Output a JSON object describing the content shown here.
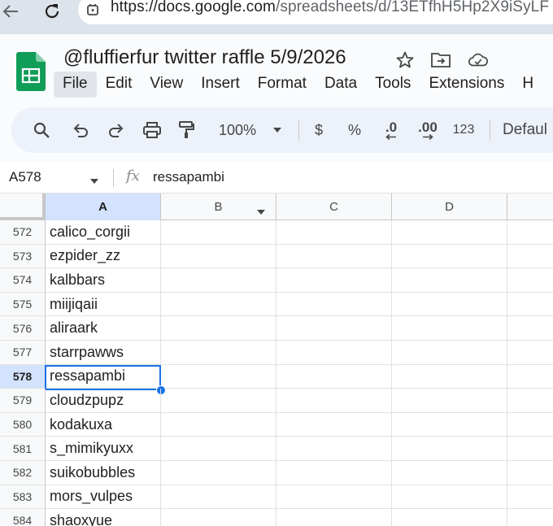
{
  "browser": {
    "url_host": "https://docs.google.com",
    "url_path": "/spreadsheets/d/13ETfhH5Hp2X9iSyLF"
  },
  "doc": {
    "title": "@fluffierfur twitter raffle 5/9/2026"
  },
  "menu": {
    "items": [
      "File",
      "Edit",
      "View",
      "Insert",
      "Format",
      "Data",
      "Tools",
      "Extensions",
      "H"
    ]
  },
  "toolbar": {
    "zoom": "100%",
    "currency": "$",
    "percent": "%",
    "decrease_decimal": ".0",
    "increase_decimal": ".00",
    "number_format": "123",
    "font": "Defaul"
  },
  "formula_bar": {
    "cell_ref": "A578",
    "fx_label": "fx",
    "value": "ressapambi"
  },
  "grid": {
    "columns": [
      "A",
      "B",
      "C",
      "D"
    ],
    "rows": [
      {
        "num": "572",
        "a": "calico_corgii"
      },
      {
        "num": "573",
        "a": "ezpider_zz"
      },
      {
        "num": "574",
        "a": "kalbbars"
      },
      {
        "num": "575",
        "a": "miijiqaii"
      },
      {
        "num": "576",
        "a": "aliraark"
      },
      {
        "num": "577",
        "a": "starrpawws"
      },
      {
        "num": "578",
        "a": "ressapambi"
      },
      {
        "num": "579",
        "a": "cloudzpupz"
      },
      {
        "num": "580",
        "a": "kodakuxa"
      },
      {
        "num": "581",
        "a": "s_mimikyuxx"
      },
      {
        "num": "582",
        "a": "suikobubbles"
      },
      {
        "num": "583",
        "a": "mors_vulpes"
      },
      {
        "num": "584",
        "a": "shaoxyue"
      }
    ],
    "selected_row": "578",
    "selected_column": "A"
  },
  "colors": {
    "accent": "#1a73e8",
    "selection_header": "#d3e3fd",
    "sheets_green": "#0f9d58"
  }
}
